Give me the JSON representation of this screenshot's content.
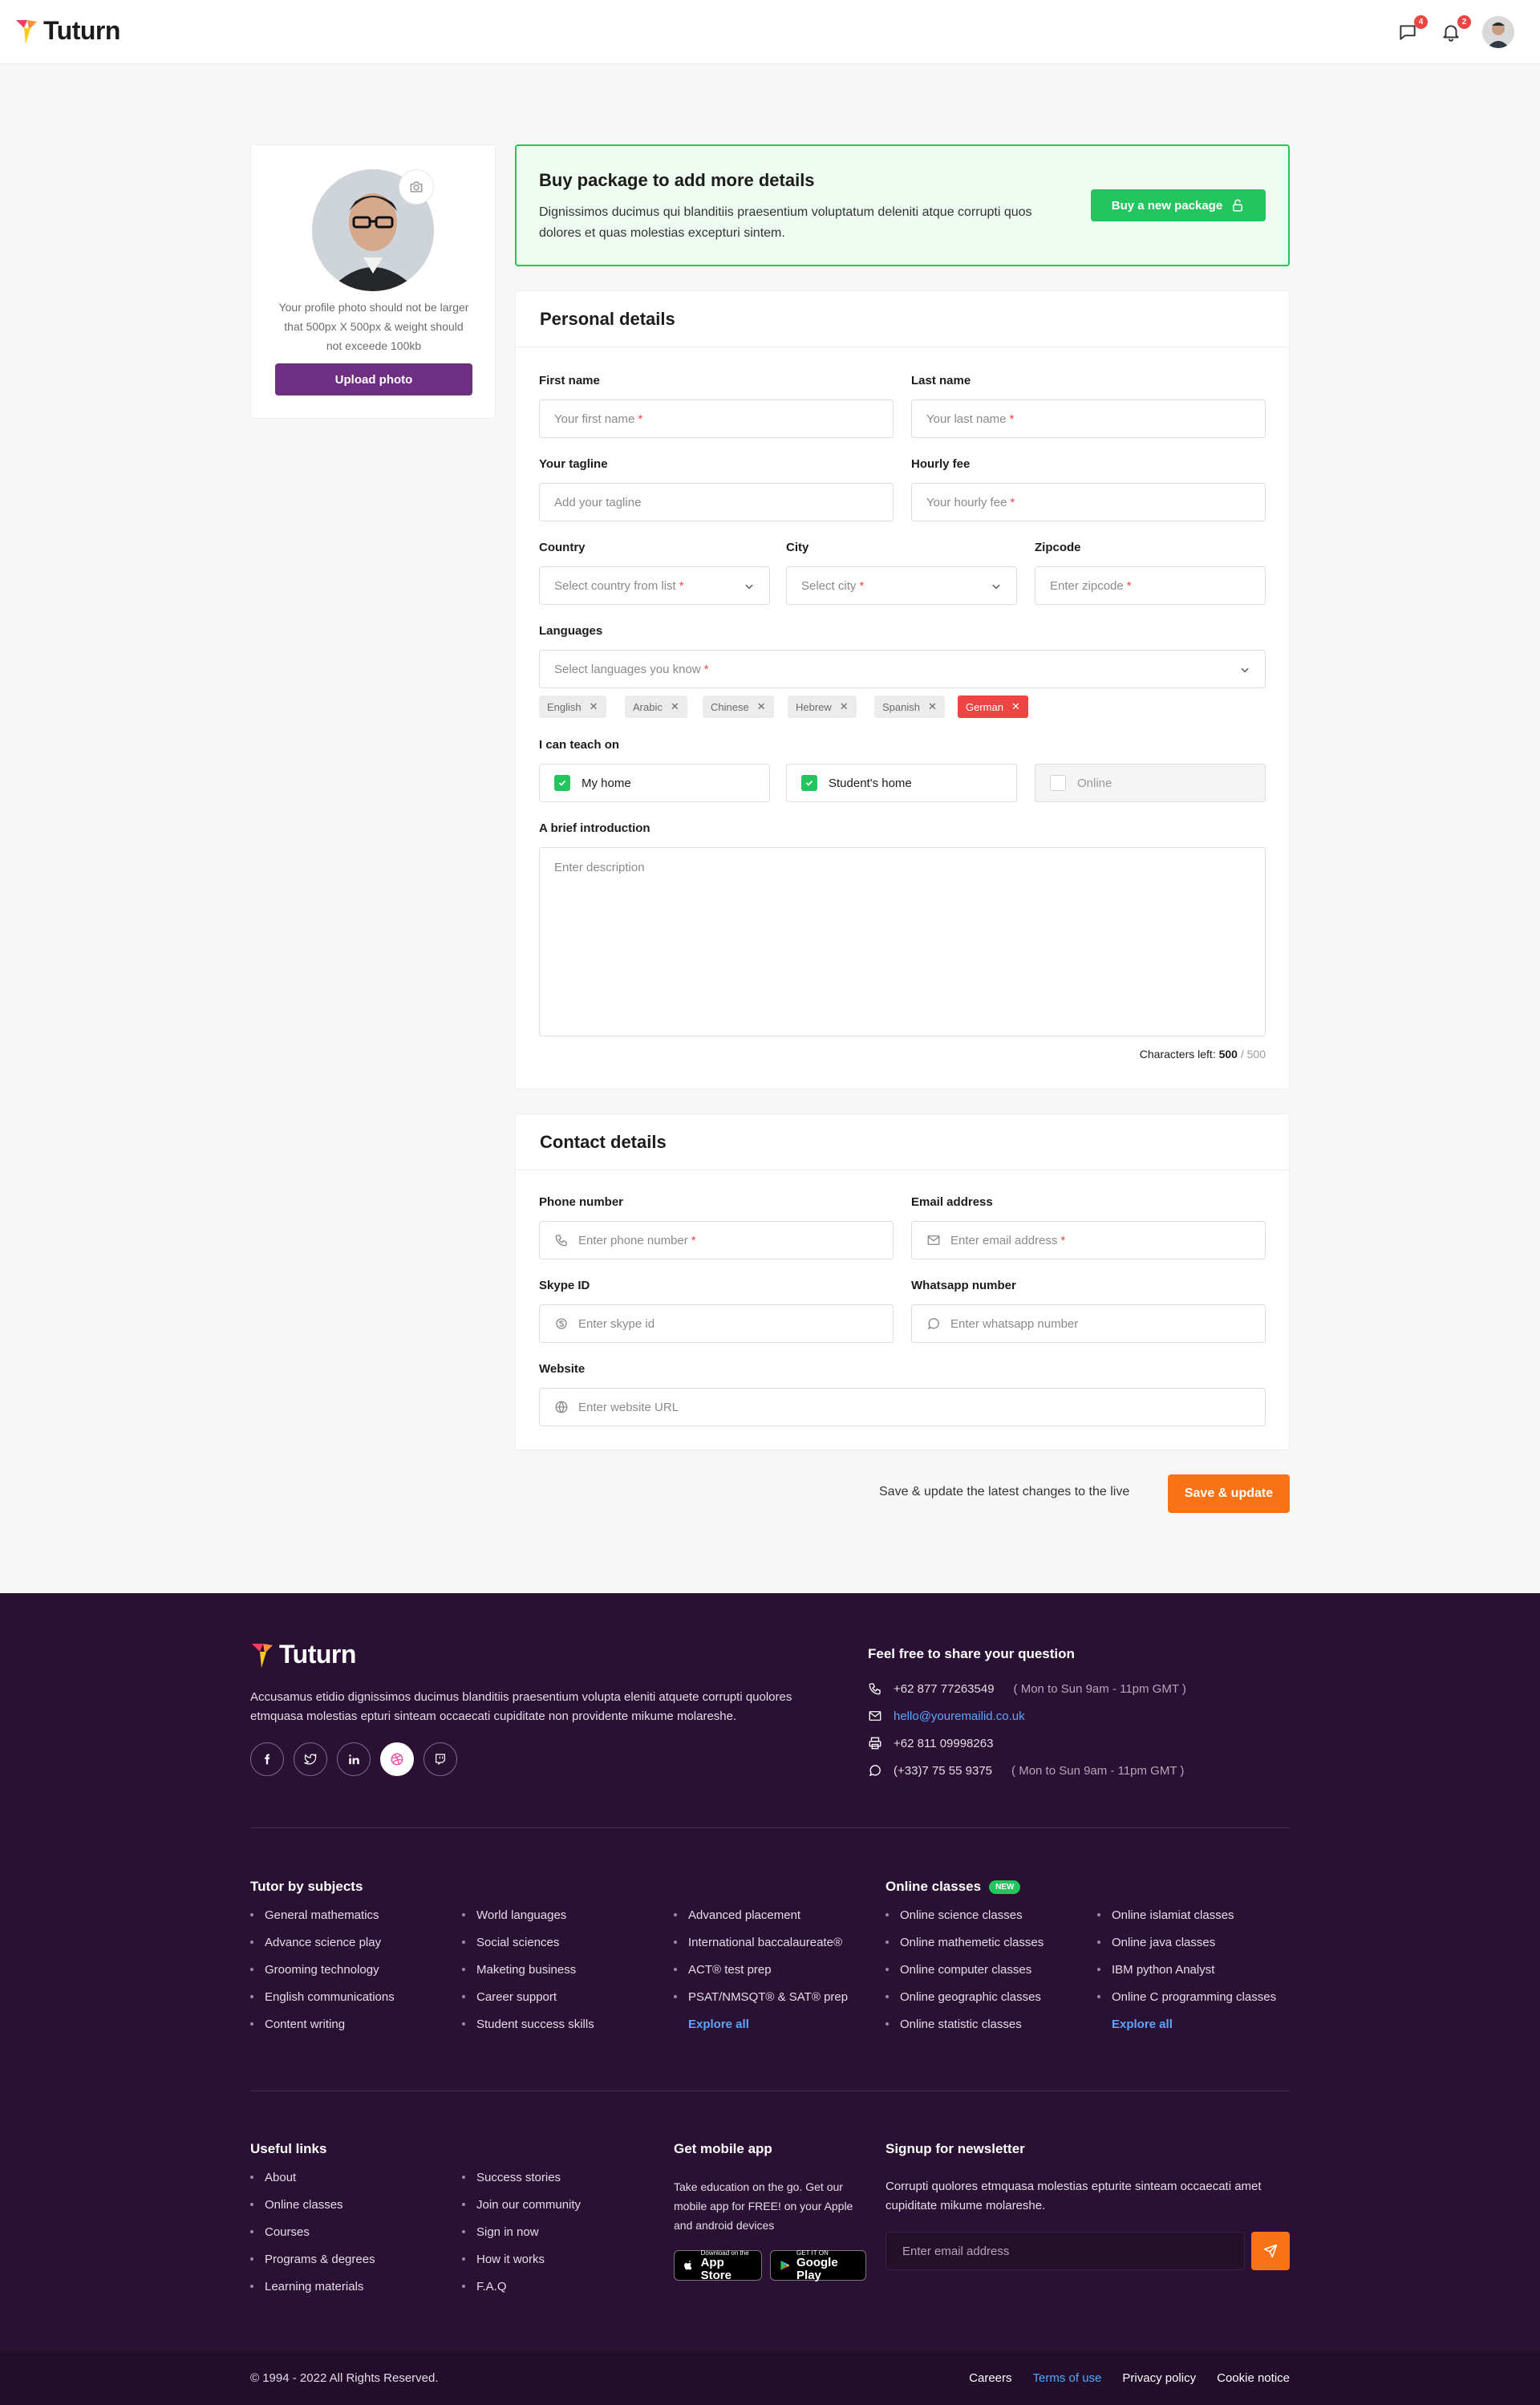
{
  "brand": {
    "name": "Tuturn"
  },
  "header": {
    "messages_count": "4",
    "notifications_count": "2",
    "icons": [
      "chat-icon",
      "bell-icon"
    ]
  },
  "profile": {
    "photo_note": "Your profile photo should not be larger that 500px X 500px & weight should not exceede 100kb",
    "upload_label": "Upload photo"
  },
  "package": {
    "title": "Buy package to add more details",
    "description": "Dignissimos ducimus qui blanditiis praesentium voluptatum deleniti atque corrupti quos dolores et quas molestias excepturi sintem.",
    "button_label": "Buy a new package"
  },
  "personal": {
    "title": "Personal details",
    "first_name": {
      "label": "First name",
      "placeholder": "Your first name"
    },
    "last_name": {
      "label": "Last name",
      "placeholder": "Your last name"
    },
    "tagline": {
      "label": "Your tagline",
      "placeholder": "Add your tagline"
    },
    "hourly_fee": {
      "label": "Hourly fee",
      "placeholder": "Your hourly fee"
    },
    "country": {
      "label": "Country",
      "placeholder": "Select country from list"
    },
    "city": {
      "label": "City",
      "placeholder": "Select city"
    },
    "zipcode": {
      "label": "Zipcode",
      "placeholder": "Enter zipcode"
    },
    "languages": {
      "label": "Languages",
      "placeholder": "Select languages you know",
      "tags": [
        "English",
        "Arabic",
        "Chinese",
        "Hebrew",
        "Spanish",
        "German"
      ],
      "active_tag": "German"
    },
    "teach_on": {
      "label": "I can teach on",
      "options": [
        {
          "label": "My home",
          "checked": true
        },
        {
          "label": "Student's home",
          "checked": true
        },
        {
          "label": "Online",
          "checked": false
        }
      ]
    },
    "introduction": {
      "label": "A brief introduction",
      "placeholder": "Enter description",
      "chars_prefix": "Characters left:",
      "chars_left": "500",
      "chars_total": "/ 500"
    },
    "required_mark": "*"
  },
  "contact": {
    "title": "Contact details",
    "phone": {
      "label": "Phone number",
      "placeholder": "Enter phone number"
    },
    "email": {
      "label": "Email address",
      "placeholder": "Enter email address"
    },
    "skype": {
      "label": "Skype ID",
      "placeholder": "Enter skype id"
    },
    "whatsapp": {
      "label": "Whatsapp number",
      "placeholder": "Enter whatsapp number"
    },
    "website": {
      "label": "Website",
      "placeholder": "Enter website URL"
    }
  },
  "save": {
    "note": "Save & update the latest changes to the live",
    "button_label": "Save & update"
  },
  "footer": {
    "description": "Accusamus etidio dignissimos ducimus blanditiis praesentium volupta eleniti atquete corrupti quolores etmquasa molestias epturi sinteam occaecati cupiditate non providente mikume molareshe.",
    "socials": [
      "facebook-icon",
      "twitter-icon",
      "linkedin-icon",
      "dribbble-icon",
      "twitch-icon"
    ],
    "question_title": "Feel free to share your question",
    "contacts": {
      "phone": "+62 877 77263549",
      "phone_hours": "( Mon to Sun 9am - 11pm GMT )",
      "email": "hello@youremailid.co.uk",
      "fax": "+62 811 09998263",
      "whatsapp": "(+33)7 75 55 9375",
      "whatsapp_hours": "( Mon to Sun 9am - 11pm GMT )"
    },
    "subjects": {
      "title": "Tutor by subjects",
      "col1": [
        "General mathematics",
        "Advance science play",
        "Grooming technology",
        "English communications",
        "Content writing"
      ],
      "col2": [
        "World languages",
        "Social sciences",
        "Maketing business",
        "Career support",
        "Student success skills"
      ],
      "col3": [
        "Advanced placement",
        "International baccalaureate®",
        "ACT® test prep",
        "PSAT/NMSQT® & SAT® prep"
      ],
      "explore": "Explore all"
    },
    "online": {
      "title": "Online classes",
      "badge": "NEW",
      "col1": [
        "Online science classes",
        "Online mathemetic classes",
        "Online computer classes",
        "Online geographic classes",
        "Online statistic classes"
      ],
      "col2": [
        "Online islamiat classes",
        "Online java classes",
        "IBM python Analyst",
        "Online C programming classes"
      ],
      "explore": "Explore all"
    },
    "useful": {
      "title": "Useful links",
      "col1": [
        "About",
        "Online classes",
        "Courses",
        "Programs & degrees",
        "Learning materials"
      ],
      "col2": [
        "Success stories",
        "Join our community",
        "Sign in now",
        "How it works",
        "F.A.Q"
      ]
    },
    "app": {
      "title": "Get mobile app",
      "description": "Take education on the go. Get our mobile app for FREE! on your Apple and android devices",
      "appstore_small": "Download on the",
      "appstore_big": "App Store",
      "googleplay_small": "GET IT ON",
      "googleplay_big": "Google Play"
    },
    "newsletter": {
      "title": "Signup for newsletter",
      "description": "Corrupti quolores etmquasa molestias epturite sinteam occaecati amet cupiditate mikume molareshe.",
      "placeholder": "Enter email address"
    },
    "copyright": "© 1994 - 2022 All Rights Reserved.",
    "bottom_links": [
      "Careers",
      "Terms of use",
      "Privacy policy",
      "Cookie notice"
    ]
  },
  "colors": {
    "brand_purple": "#6e2f83",
    "success_green": "#22c55e",
    "accent_orange": "#f97316",
    "danger_red": "#ef4444",
    "footer_bg": "#2a1134",
    "link_blue": "#5aa6ff"
  }
}
